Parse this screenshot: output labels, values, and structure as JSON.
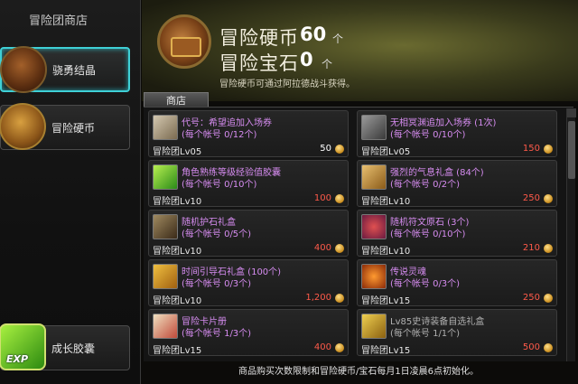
{
  "sidebar": {
    "title": "冒险团商店",
    "items": [
      {
        "label": "骁勇结晶",
        "icon": "crystal-icon",
        "active": true
      },
      {
        "label": "冒险硬币",
        "icon": "coin-chest-icon",
        "active": false
      },
      {
        "label": "成长胶囊",
        "icon": "exp-capsule-icon",
        "active": false
      }
    ],
    "exp_badge": "EXP"
  },
  "header": {
    "currencies": [
      {
        "label": "冒险硬币",
        "value": "60",
        "unit": "个"
      },
      {
        "label": "冒险宝石",
        "value": "0",
        "unit": "个"
      }
    ],
    "note": "冒险硬币可通过阿拉德战斗获得。"
  },
  "shop": {
    "tab_label": "商店",
    "items": [
      {
        "name": "代号：希望追加入场券",
        "limit": "(每个帐号 0/12个)",
        "req": "冒险团Lv05",
        "price": "50",
        "affordable": true,
        "icon": "ticket-icon",
        "color": "#d68cf0"
      },
      {
        "name": "无相冥渊追加入场券 (1次)",
        "limit": "(每个帐号 0/10个)",
        "req": "冒险团Lv05",
        "price": "150",
        "affordable": false,
        "icon": "ticket-icon",
        "color": "#d68cf0"
      },
      {
        "name": "角色熟练等级经验值胶囊",
        "limit": "(每个帐号 0/10个)",
        "req": "冒险团Lv10",
        "price": "100",
        "affordable": false,
        "icon": "exp-capsule-icon",
        "color": "#d68cf0"
      },
      {
        "name": "强烈的气息礼盒 (84个)",
        "limit": "(每个帐号 0/2个)",
        "req": "冒险团Lv10",
        "price": "250",
        "affordable": false,
        "icon": "gift-box-icon",
        "color": "#d68cf0"
      },
      {
        "name": "随机护石礼盒",
        "limit": "(每个帐号 0/5个)",
        "req": "冒险团Lv10",
        "price": "400",
        "affordable": false,
        "icon": "stone-box-icon",
        "color": "#d68cf0"
      },
      {
        "name": "随机符文原石 (3个)",
        "limit": "(每个帐号 0/10个)",
        "req": "冒险团Lv10",
        "price": "210",
        "affordable": false,
        "icon": "rune-stone-icon",
        "color": "#d68cf0"
      },
      {
        "name": "时间引导石礼盒 (100个)",
        "limit": "(每个帐号 0/3个)",
        "req": "冒险团Lv10",
        "price": "1,200",
        "affordable": false,
        "icon": "guide-stone-icon",
        "color": "#d68cf0"
      },
      {
        "name": "传说灵魂",
        "limit": "(每个帐号 0/3个)",
        "req": "冒险团Lv15",
        "price": "250",
        "affordable": false,
        "icon": "soul-icon",
        "color": "#d68cf0"
      },
      {
        "name": "冒险卡片册",
        "limit": "(每个帐号 1/3个)",
        "req": "冒险团Lv15",
        "price": "400",
        "affordable": false,
        "icon": "card-album-icon",
        "color": "#d68cf0"
      },
      {
        "name": "Lv85史诗装备自选礼盒",
        "limit": "(每个帐号 1/1个)",
        "req": "冒险团Lv15",
        "price": "500",
        "affordable": false,
        "icon": "epic-box-icon",
        "color": "#b0b0b0"
      }
    ]
  },
  "footer": "商品购买次数限制和冒险硬币/宝石每月1日凌晨6点初始化。"
}
